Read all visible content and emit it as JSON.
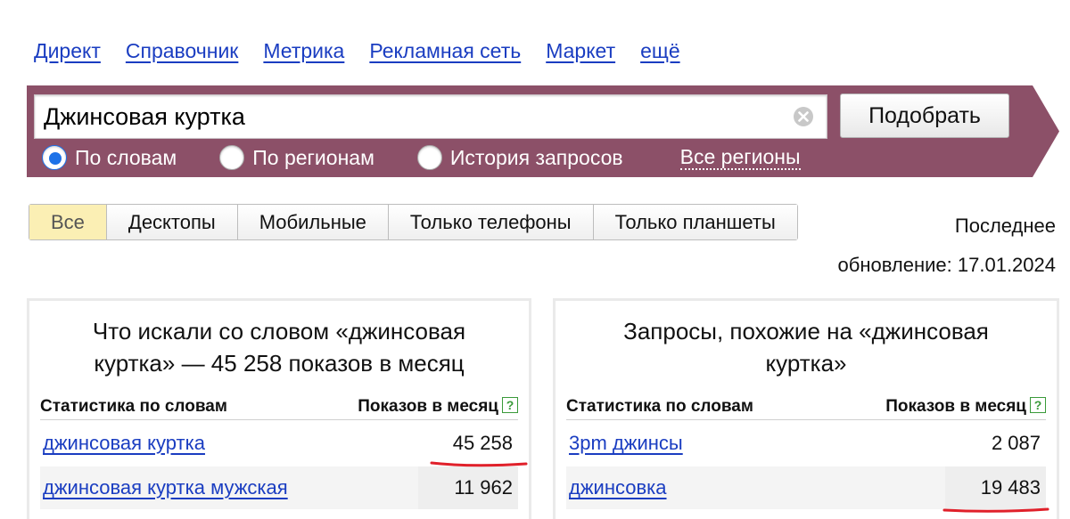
{
  "top_nav": [
    "Директ",
    "Справочник",
    "Метрика",
    "Рекламная сеть",
    "Маркет",
    "ещё"
  ],
  "search": {
    "value": "Джинсовая куртка",
    "submit_label": "Подобрать",
    "modes": [
      "По словам",
      "По регионам",
      "История запросов"
    ],
    "selected_mode": "По словам",
    "regions_label": "Все регионы"
  },
  "device_tabs": [
    "Все",
    "Десктопы",
    "Мобильные",
    "Только телефоны",
    "Только планшеты"
  ],
  "active_tab": "Все",
  "update": {
    "line1": "Последнее",
    "line2": "обновление: 17.01.2024"
  },
  "left_panel": {
    "title_line1": "Что искали со словом «джинсовая",
    "title_line2": "куртка» — 45 258 показов в месяц",
    "col_words": "Статистика по словам",
    "col_shows": "Показов в месяц",
    "rows": [
      {
        "keyword": "джинсовая куртка",
        "shows": "45 258"
      },
      {
        "keyword": "джинсовая куртка мужская",
        "shows": "11 962"
      }
    ]
  },
  "right_panel": {
    "title_line1": "Запросы, похожие на «джинсовая",
    "title_line2": "куртка»",
    "col_words": "Статистика по словам",
    "col_shows": "Показов в месяц",
    "rows": [
      {
        "keyword": "3pm джинсы",
        "shows": "2 087"
      },
      {
        "keyword": "джинсовка",
        "shows": "19 483"
      }
    ]
  },
  "help_symbol": "?",
  "colors": {
    "band": "#8c5068",
    "link": "#1a3dc1",
    "active_tab": "#fbefb4",
    "annotation": "#e0202a",
    "radio_on": "#1d72e8"
  }
}
